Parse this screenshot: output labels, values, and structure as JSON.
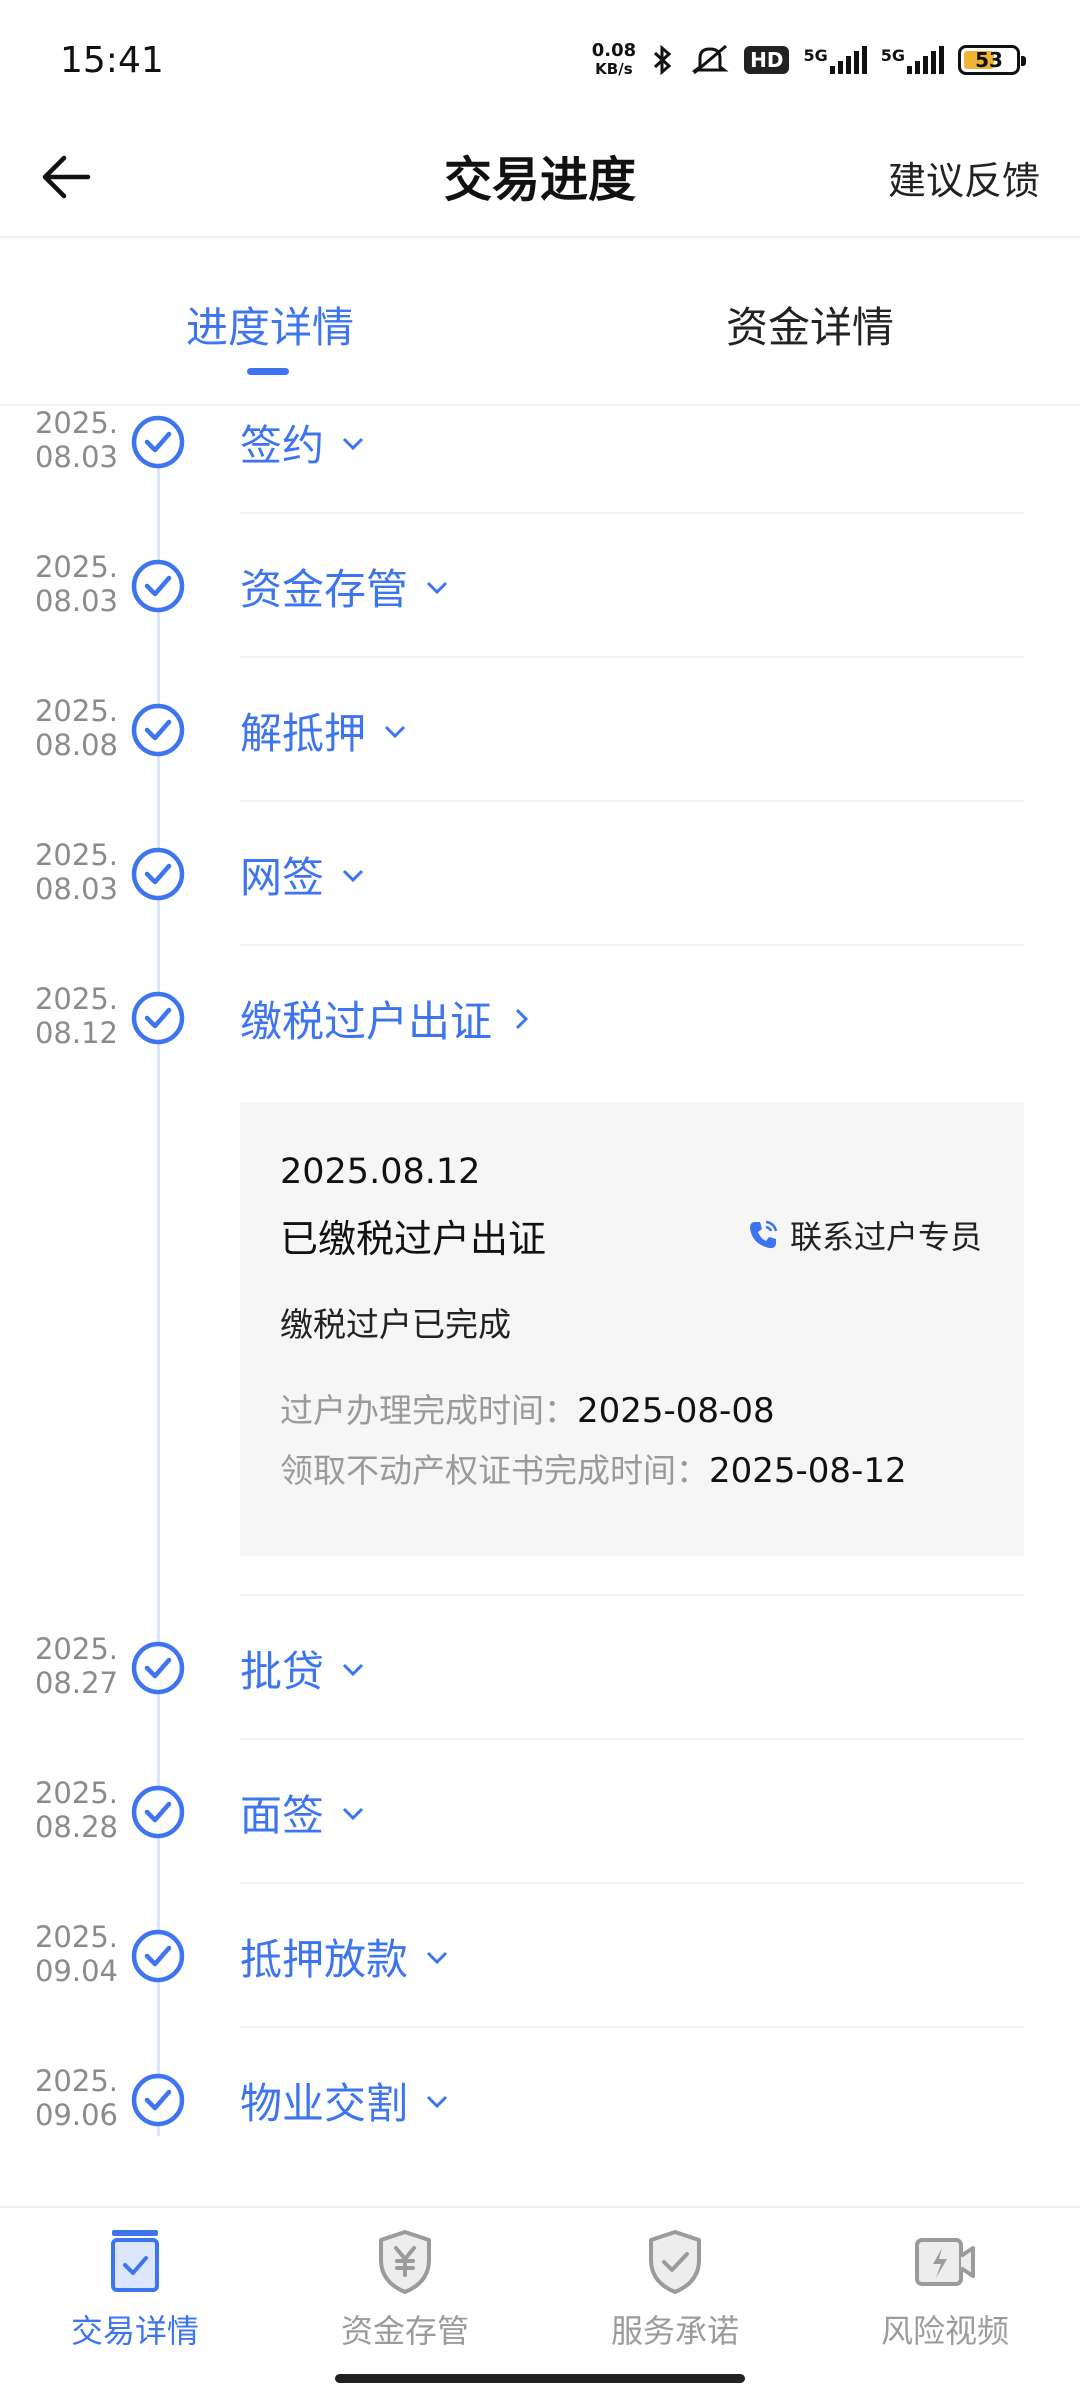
{
  "status_bar": {
    "time": "15:41",
    "net_speed_value": "0.08",
    "net_speed_unit": "KB/s",
    "hd_label": "HD",
    "signal1_label": "5G",
    "signal2_label": "5G",
    "battery_level": "53"
  },
  "header": {
    "title": "交易进度",
    "feedback_label": "建议反馈"
  },
  "tabs": [
    {
      "label": "进度详情",
      "active": true
    },
    {
      "label": "资金详情",
      "active": false
    }
  ],
  "steps": [
    {
      "date_line1": "2025.",
      "date_line2": "08.03",
      "title": "签约",
      "expanded": false
    },
    {
      "date_line1": "2025.",
      "date_line2": "08.03",
      "title": "资金存管",
      "expanded": false
    },
    {
      "date_line1": "2025.",
      "date_line2": "08.08",
      "title": "解抵押",
      "expanded": false
    },
    {
      "date_line1": "2025.",
      "date_line2": "08.03",
      "title": "网签",
      "expanded": false
    },
    {
      "date_line1": "2025.",
      "date_line2": "08.12",
      "title": "缴税过户出证",
      "expanded": true
    },
    {
      "date_line1": "2025.",
      "date_line2": "08.27",
      "title": "批贷",
      "expanded": false
    },
    {
      "date_line1": "2025.",
      "date_line2": "08.28",
      "title": "面签",
      "expanded": false
    },
    {
      "date_line1": "2025.",
      "date_line2": "09.04",
      "title": "抵押放款",
      "expanded": false
    },
    {
      "date_line1": "2025.",
      "date_line2": "09.06",
      "title": "物业交割",
      "expanded": false
    }
  ],
  "detail_card": {
    "date": "2025.08.12",
    "title": "已缴税过户出证",
    "contact_label": "联系过户专员",
    "status_text": "缴税过户已完成",
    "rows": [
      {
        "label": "过户办理完成时间：",
        "value": "2025-08-08"
      },
      {
        "label": "领取不动产权证书完成时间：",
        "value": "2025-08-12"
      }
    ]
  },
  "bottom_nav": [
    {
      "label": "交易详情",
      "icon": "document-check-icon",
      "active": true
    },
    {
      "label": "资金存管",
      "icon": "shield-yen-icon",
      "active": false
    },
    {
      "label": "服务承诺",
      "icon": "shield-check-icon",
      "active": false
    },
    {
      "label": "风险视频",
      "icon": "video-lightning-icon",
      "active": false
    }
  ],
  "colors": {
    "accent": "#3d74f0",
    "muted": "#9b9b9b"
  }
}
